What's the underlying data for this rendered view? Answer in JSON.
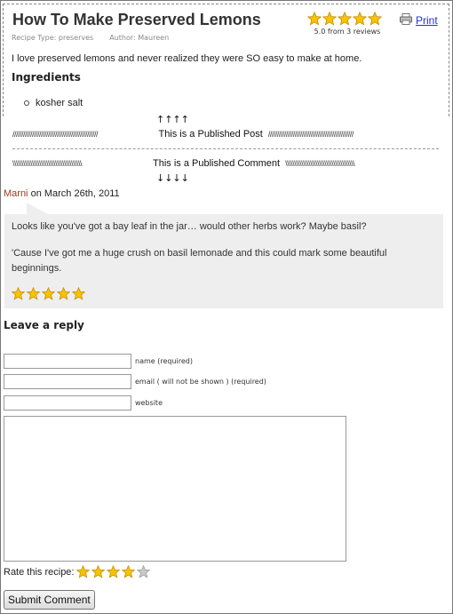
{
  "recipe": {
    "title": "How To Make Preserved Lemons",
    "rating_summary": "5.0 from 3 reviews",
    "rating_value": 5,
    "print_label": "Print",
    "recipe_type": "Recipe Type: preserves",
    "author": "Author: Maureen",
    "intro": "I love preserved lemons and never realized they were SO easy to make at home.",
    "ingredients_heading": "Ingredients",
    "ingredients": [
      "kosher salt"
    ]
  },
  "markers": {
    "up_arrows": "↑↑↑↑",
    "post_label": "This is a Published Post",
    "post_slashes": "////////////////////////////////////////////////",
    "comment_label": "This is a Published Comment",
    "comment_slashes": "\\\\\\\\\\\\\\\\\\\\\\\\\\\\\\\\\\\\\\\\\\\\\\\\\\\\\\\\\\\\\\\\\\\\\\\\\\\\\\",
    "down_arrows": "↓↓↓↓"
  },
  "comment": {
    "author": "Marni",
    "date_text": " on March 26th, 2011",
    "paragraphs": [
      "Looks like you've got a bay leaf in the jar… would other herbs work? Maybe basil?",
      "'Cause I've got me a huge crush on basil lemonade and this could mark some beautiful beginnings."
    ],
    "rating_value": 5
  },
  "reply_form": {
    "heading": "Leave a reply",
    "name_label": "name (required)",
    "name_value": "",
    "email_label": "email ( will not be shown ) (required)",
    "email_value": "",
    "website_label": "website",
    "website_value": "",
    "comment_value": "",
    "rate_label": "Rate this recipe:",
    "rate_value": 4,
    "submit_label": "Submit Comment"
  },
  "colors": {
    "star_fill": "#f5c400",
    "star_empty": "#c8c8c8",
    "link": "#2233cc",
    "author": "#9a3b1b",
    "bubble": "#eeeeee"
  }
}
